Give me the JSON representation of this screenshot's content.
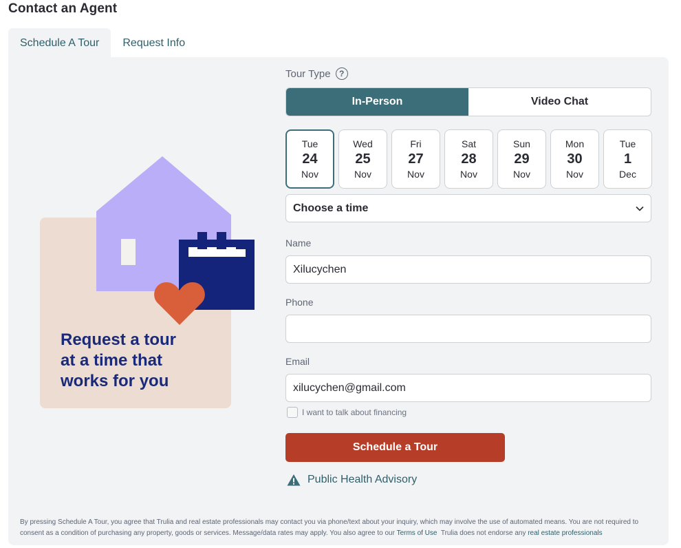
{
  "page": {
    "title": "Contact an Agent"
  },
  "tabs": [
    {
      "label": "Schedule A Tour",
      "active": true
    },
    {
      "label": "Request Info",
      "active": false
    }
  ],
  "illustration": {
    "promo_text": "Request a tour\nat a time that\nworks for you",
    "colors": {
      "card": "#ecdcd2",
      "house": "#b9aef7",
      "calendar": "#14247a",
      "heart": "#d95f3b",
      "text": "#1b2a78"
    }
  },
  "form": {
    "tour_type_label": "Tour Type",
    "help_icon": "question-circle-icon",
    "tour_types": [
      {
        "label": "In-Person",
        "active": true
      },
      {
        "label": "Video Chat",
        "active": false
      }
    ],
    "dates": [
      {
        "dow": "Tue",
        "day": "24",
        "month": "Nov",
        "selected": true
      },
      {
        "dow": "Wed",
        "day": "25",
        "month": "Nov",
        "selected": false
      },
      {
        "dow": "Fri",
        "day": "27",
        "month": "Nov",
        "selected": false
      },
      {
        "dow": "Sat",
        "day": "28",
        "month": "Nov",
        "selected": false
      },
      {
        "dow": "Sun",
        "day": "29",
        "month": "Nov",
        "selected": false
      },
      {
        "dow": "Mon",
        "day": "30",
        "month": "Nov",
        "selected": false
      },
      {
        "dow": "Tue",
        "day": "1",
        "month": "Dec",
        "selected": false
      }
    ],
    "time_select": {
      "value": "Choose a time"
    },
    "name": {
      "label": "Name",
      "value": "Xilucychen"
    },
    "phone": {
      "label": "Phone",
      "value": ""
    },
    "email": {
      "label": "Email",
      "value": "xilucychen@gmail.com"
    },
    "financing": {
      "label": "I want to talk about financing",
      "checked": false
    },
    "submit_label": "Schedule a Tour",
    "advisory_label": "Public Health Advisory"
  },
  "disclaimer": {
    "text": "By pressing Schedule A Tour, you agree that Trulia and real estate professionals may contact you via phone/text about your inquiry, which may involve the use of automated means. You are not required to consent as a condition of purchasing any property, goods or services. Message/data rates may apply. You also agree to our ",
    "terms_link": "Terms of Use",
    "middle": "  Trulia does not endorse any ",
    "pro_link": "real estate professionals"
  },
  "colors": {
    "accent": "#3c6e79",
    "submit": "#b63e28",
    "panel_bg": "#f2f3f5",
    "link": "#2f5f6a"
  }
}
